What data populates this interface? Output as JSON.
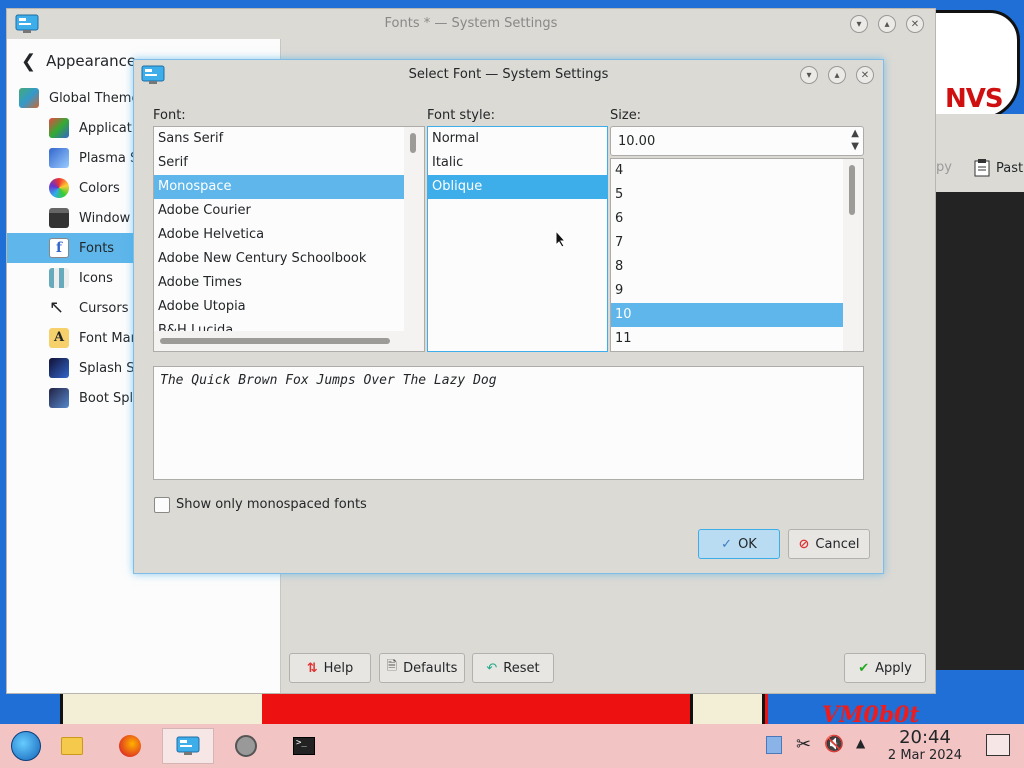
{
  "colors": {
    "accent": "#3daee9",
    "selection": "#5eb6ea",
    "window_bg": "#dcdad5",
    "view_bg": "#fcfcfc",
    "taskbar": "#f2c4c4"
  },
  "desktop": {
    "wallpaper_text": "NVS",
    "wallpaper_tag": "VM0b0t"
  },
  "konsole": {
    "copy_label": "py",
    "paste_label": "Past"
  },
  "main_window": {
    "title": "Fonts * — System Settings",
    "sidebar": {
      "back_label": "Appearance",
      "items": [
        {
          "label": "Global Theme",
          "icon": "global-theme-icon"
        },
        {
          "label": "Applicatio",
          "icon": "application-style-icon"
        },
        {
          "label": "Plasma S",
          "icon": "plasma-style-icon"
        },
        {
          "label": "Colors",
          "icon": "colors-icon"
        },
        {
          "label": "Window",
          "icon": "window-decorations-icon"
        },
        {
          "label": "Fonts",
          "icon": "fonts-icon"
        },
        {
          "label": "Icons",
          "icon": "icons-icon"
        },
        {
          "label": "Cursors",
          "icon": "cursors-icon"
        },
        {
          "label": "Font Mar",
          "icon": "font-management-icon"
        },
        {
          "label": "Splash Sc",
          "icon": "splash-screen-icon"
        },
        {
          "label": "Boot Spla",
          "icon": "boot-splash-icon"
        }
      ],
      "selected_index": 5
    },
    "buttons": {
      "help": "Help",
      "defaults": "Defaults",
      "reset": "Reset",
      "apply": "Apply"
    }
  },
  "dialog": {
    "title": "Select Font — System Settings",
    "font_label": "Font:",
    "style_label": "Font style:",
    "size_label": "Size:",
    "fonts": [
      "Sans Serif",
      "Serif",
      "Monospace",
      "Adobe Courier",
      "Adobe Helvetica",
      "Adobe New Century Schoolbook",
      "Adobe Times",
      "Adobe Utopia",
      "B&H Lucida"
    ],
    "selected_font": "Monospace",
    "styles": [
      "Normal",
      "Italic",
      "Oblique"
    ],
    "selected_style": "Oblique",
    "size_value": "10.00",
    "sizes": [
      "4",
      "5",
      "6",
      "7",
      "8",
      "9",
      "10",
      "11"
    ],
    "selected_size": "10",
    "preview_text": "The Quick Brown Fox Jumps Over The Lazy Dog",
    "monospaced_only_label": "Show only monospaced fonts",
    "monospaced_only_checked": false,
    "ok_label": "OK",
    "cancel_label": "Cancel"
  },
  "taskbar": {
    "time": "20:44",
    "date": "2 Mar 2024",
    "tasks": [
      "start-menu-icon",
      "file-manager-icon",
      "firefox-icon",
      "system-settings-icon",
      "clock-app-icon",
      "konsole-icon"
    ]
  }
}
